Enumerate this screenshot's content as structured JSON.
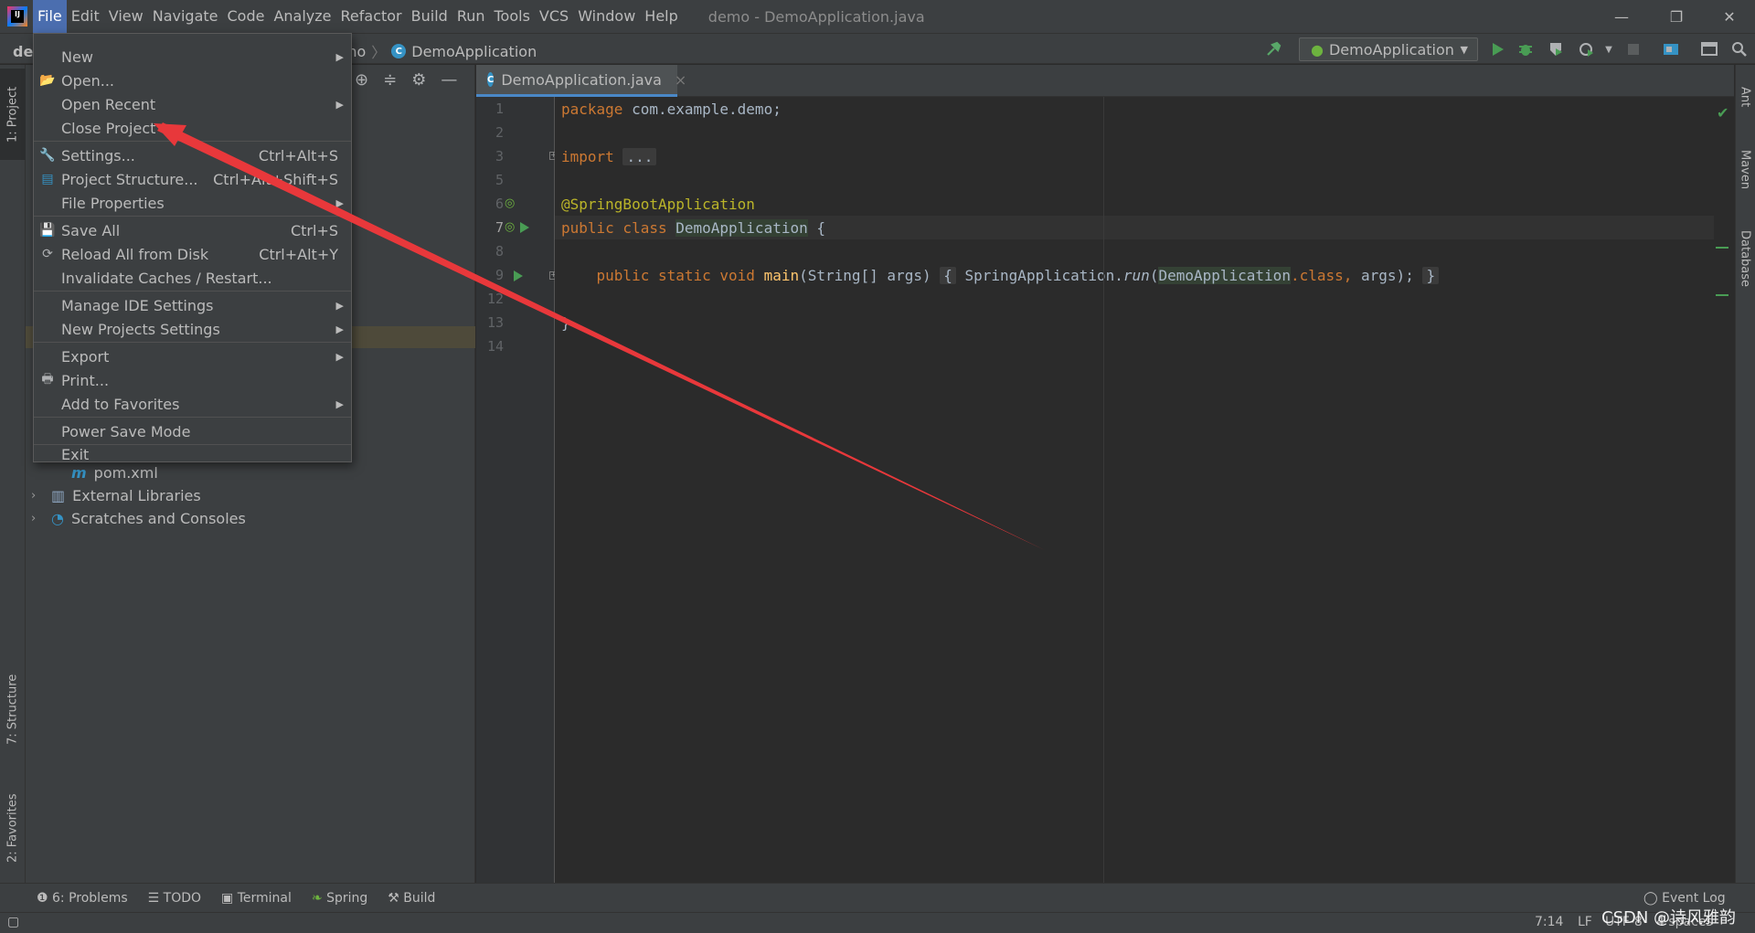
{
  "window": {
    "title": "demo - DemoApplication.java",
    "logo_text": "IJ",
    "minimize": "—",
    "restore": "❐",
    "close": "✕"
  },
  "menubar": [
    "File",
    "Edit",
    "View",
    "Navigate",
    "Code",
    "Analyze",
    "Refactor",
    "Build",
    "Run",
    "Tools",
    "VCS",
    "Window",
    "Help"
  ],
  "breadcrumb": {
    "project_stub": "de",
    "module_stub": "no",
    "separator": "〉",
    "class_name": "DemoApplication"
  },
  "toolbar": {
    "run_config": "DemoApplication",
    "dropdown": "▼"
  },
  "left_tool_windows": {
    "project": "1: Project",
    "structure": "7: Structure",
    "favorites": "2: Favorites"
  },
  "right_tool_windows": {
    "ant": "Ant",
    "maven": "Maven",
    "database": "Database"
  },
  "project_tree": [
    {
      "label": "pom.xml",
      "icon": "maven-file-icon",
      "arrow": ""
    },
    {
      "label": "External Libraries",
      "icon": "libraries-icon",
      "arrow": "›"
    },
    {
      "label": "Scratches and Consoles",
      "icon": "scratches-icon",
      "arrow": "›"
    }
  ],
  "editor": {
    "tab_label": "DemoApplication.java",
    "tab_close": "×",
    "line_numbers": [
      "1",
      "2",
      "3",
      "5",
      "6",
      "7",
      "8",
      "9",
      "12",
      "13",
      "14"
    ],
    "code": {
      "l1_kw": "package",
      "l1_rest": " com.example.demo;",
      "l3_kw": "import",
      "l3_fold": "...",
      "l6_ann": "@SpringBootApplication",
      "l7_kw": "public class",
      "l7_name": "DemoApplication",
      "l7_rest": " {",
      "l9_kw": "public static void",
      "l9_fn": "main",
      "l9_args": "(String[] args)",
      "l9_open": "{",
      "l9_body_a": " SpringApplication.",
      "l9_run": "run",
      "l9_paren": "(",
      "l9_cls": "DemoApplication",
      "l9_dotclass": ".class,",
      "l9_end": " args);",
      "l9_close": "}",
      "l13": "}"
    }
  },
  "file_menu": [
    {
      "label": "New",
      "shortcut": "",
      "submenu": true,
      "icon": ""
    },
    {
      "label": "Open...",
      "shortcut": "",
      "submenu": false,
      "icon": "folder-open-icon"
    },
    {
      "label": "Open Recent",
      "shortcut": "",
      "submenu": true,
      "icon": ""
    },
    {
      "label": "Close Project",
      "shortcut": "",
      "submenu": false,
      "icon": ""
    },
    {
      "label": "Settings...",
      "shortcut": "Ctrl+Alt+S",
      "submenu": false,
      "icon": "wrench-icon"
    },
    {
      "label": "Project Structure...",
      "shortcut": "Ctrl+Alt+Shift+S",
      "submenu": false,
      "icon": "project-structure-icon"
    },
    {
      "label": "File Properties",
      "shortcut": "",
      "submenu": true,
      "icon": ""
    },
    {
      "label": "Save All",
      "shortcut": "Ctrl+S",
      "submenu": false,
      "icon": "save-icon"
    },
    {
      "label": "Reload All from Disk",
      "shortcut": "Ctrl+Alt+Y",
      "submenu": false,
      "icon": "reload-icon"
    },
    {
      "label": "Invalidate Caches / Restart...",
      "shortcut": "",
      "submenu": false,
      "icon": ""
    },
    {
      "label": "Manage IDE Settings",
      "shortcut": "",
      "submenu": true,
      "icon": ""
    },
    {
      "label": "New Projects Settings",
      "shortcut": "",
      "submenu": true,
      "icon": ""
    },
    {
      "label": "Export",
      "shortcut": "",
      "submenu": true,
      "icon": ""
    },
    {
      "label": "Print...",
      "shortcut": "",
      "submenu": false,
      "icon": "print-icon"
    },
    {
      "label": "Add to Favorites",
      "shortcut": "",
      "submenu": true,
      "icon": ""
    },
    {
      "label": "Power Save Mode",
      "shortcut": "",
      "submenu": false,
      "icon": ""
    },
    {
      "label": "Exit",
      "shortcut": "",
      "submenu": false,
      "icon": ""
    }
  ],
  "bottom_tools": {
    "problems": "6: Problems",
    "todo": "TODO",
    "terminal": "Terminal",
    "spring": "Spring",
    "build": "Build",
    "event_log": "Event Log"
  },
  "status": {
    "position": "7:14",
    "line_sep": "LF",
    "encoding": "UTF-8",
    "indent": "4 spaces"
  },
  "watermark": "CSDN @诗风雅韵",
  "colors": {
    "accent": "#4b6eaf",
    "annotation_arrow": "#e8383b",
    "keyword": "#cc7832",
    "annotation": "#bbb529",
    "function": "#ffc66d"
  }
}
